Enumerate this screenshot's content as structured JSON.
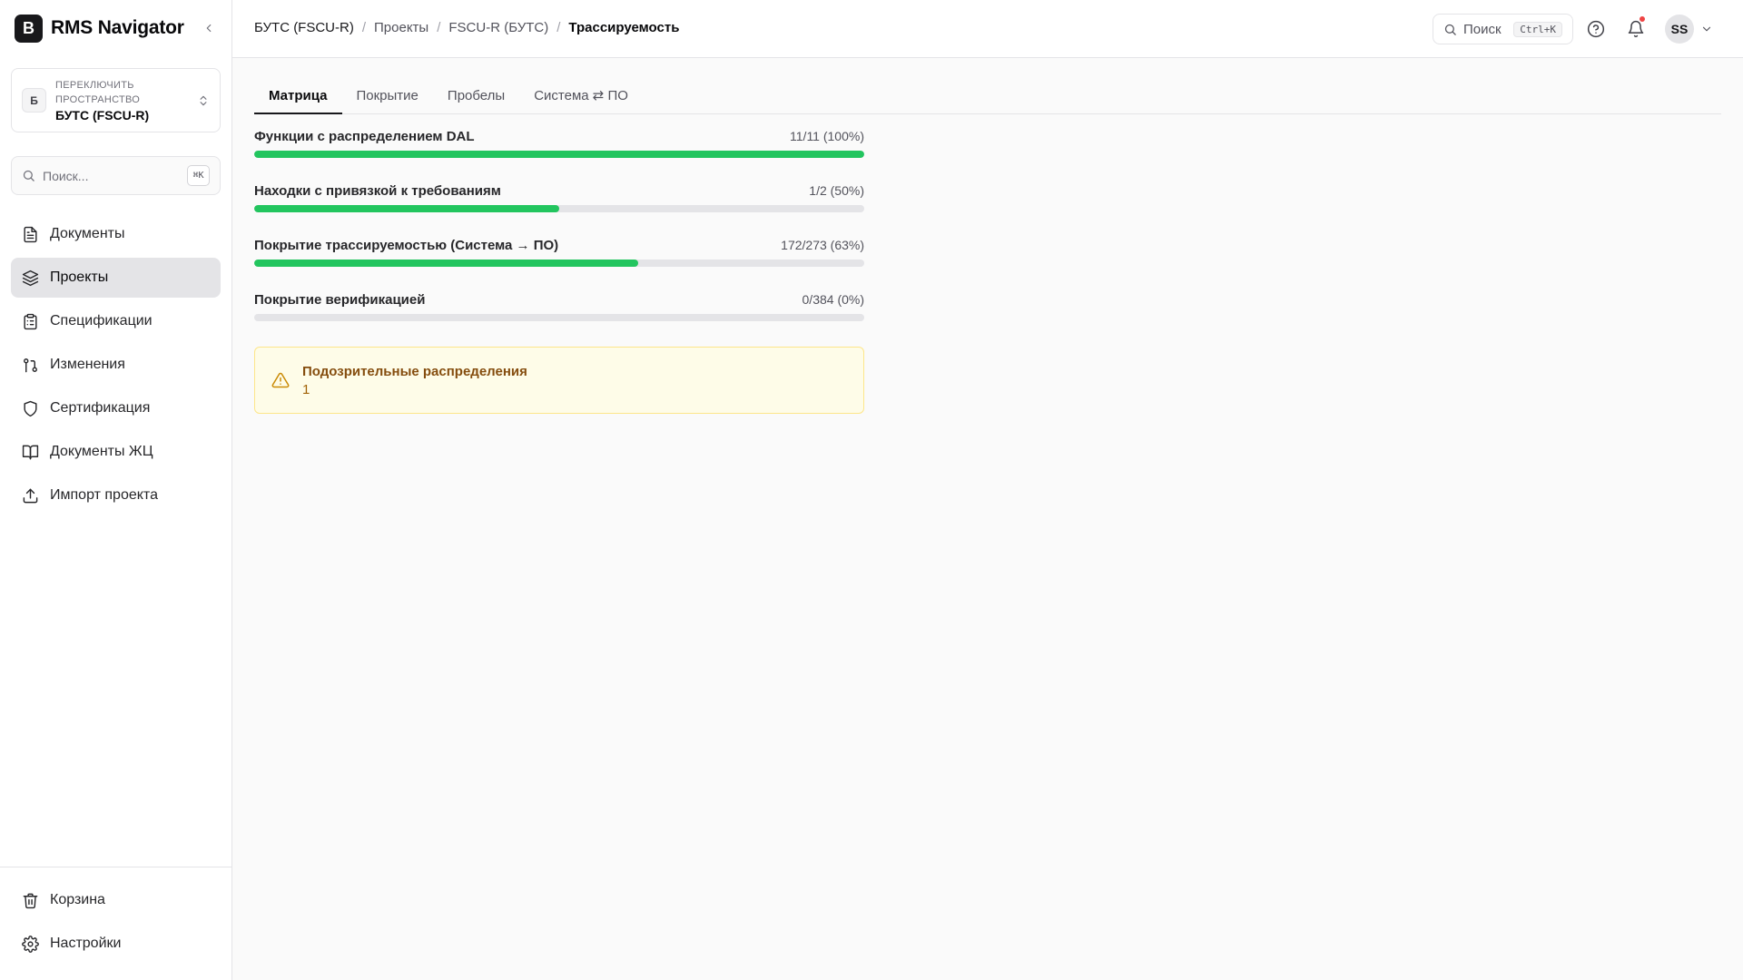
{
  "app": {
    "logo_letter": "B",
    "name": "RMS Navigator"
  },
  "space": {
    "avatar_letter": "Б",
    "caption": "Переключить пространство",
    "name": "БУТС (FSCU-R)"
  },
  "sidebar_search": {
    "placeholder": "Поиск...",
    "shortcut": "⌘K"
  },
  "nav": {
    "items": [
      {
        "label": "Документы",
        "icon": "file-text-icon"
      },
      {
        "label": "Проекты",
        "icon": "layers-icon",
        "active": true
      },
      {
        "label": "Спецификации",
        "icon": "clipboard-list-icon"
      },
      {
        "label": "Изменения",
        "icon": "git-pull-request-icon"
      },
      {
        "label": "Сертификация",
        "icon": "shield-icon"
      },
      {
        "label": "Документы ЖЦ",
        "icon": "book-open-icon"
      },
      {
        "label": "Импорт проекта",
        "icon": "upload-icon"
      }
    ],
    "bottom": [
      {
        "label": "Корзина",
        "icon": "trash-icon"
      },
      {
        "label": "Настройки",
        "icon": "gear-icon"
      }
    ]
  },
  "breadcrumb": [
    "БУТС (FSCU-R)",
    "Проекты",
    "FSCU-R (БУТС)",
    "Трассируемость"
  ],
  "header": {
    "search_label": "Поиск",
    "search_shortcut": "Ctrl+K",
    "user_initials": "SS",
    "has_unread_notifications": true
  },
  "tabs": [
    {
      "label": "Матрица",
      "active": true
    },
    {
      "label": "Покрытие"
    },
    {
      "label": "Пробелы"
    },
    {
      "label": "Система ⇄ ПО"
    }
  ],
  "metrics": [
    {
      "label": "Функции с распределением DAL",
      "value": "11/11 (100%)",
      "percent": 100
    },
    {
      "label": "Находки с привязкой к требованиям",
      "value": "1/2 (50%)",
      "percent": 50
    },
    {
      "label": "Покрытие трассируемостью (Система → ПО)",
      "value": "172/273 (63%)",
      "percent": 63
    },
    {
      "label": "Покрытие верификацией",
      "value": "0/384 (0%)",
      "percent": 0
    }
  ],
  "warning": {
    "title": "Подозрительные распределения",
    "count": "1"
  },
  "colors": {
    "progress_fill": "#22c55e",
    "progress_track": "#e4e4e7",
    "warning_bg": "#fefce8",
    "warning_border": "#fde68a",
    "active_nav_bg": "#e4e4e7",
    "notification_dot": "#ef4444"
  }
}
